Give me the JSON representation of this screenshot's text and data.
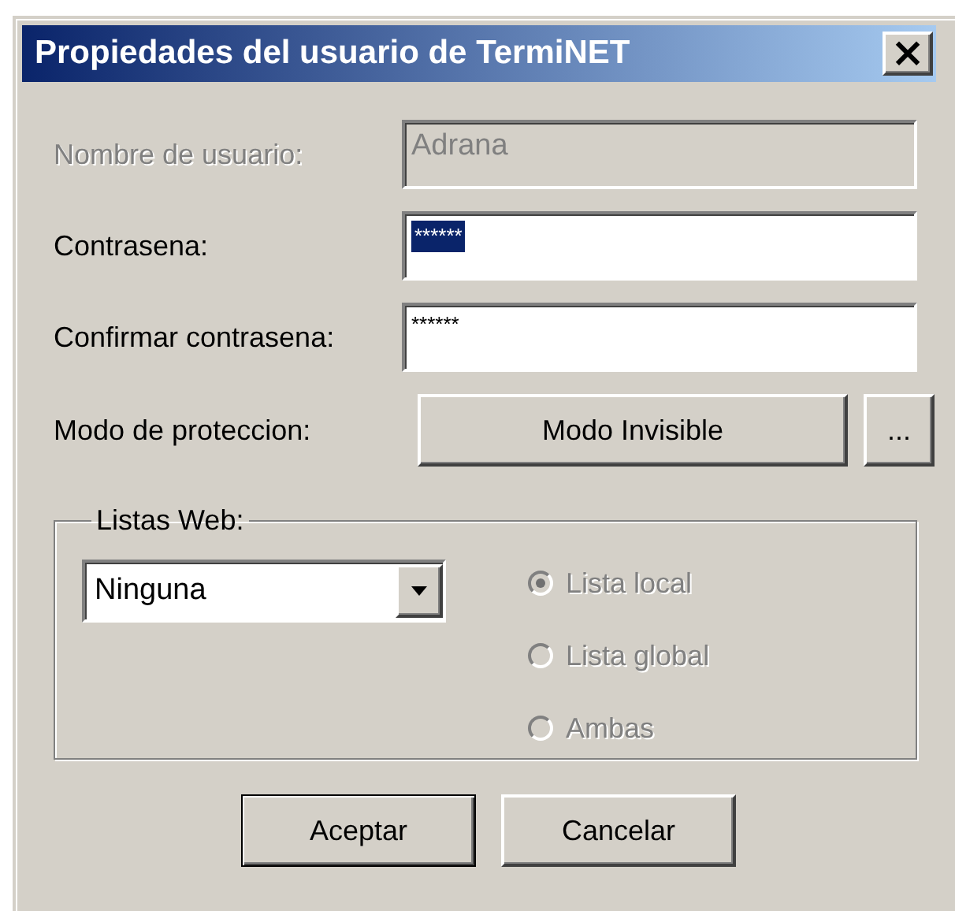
{
  "window": {
    "title": "Propiedades del usuario de TermiNET",
    "close": "×"
  },
  "fields": [
    {
      "label": "Nombre de usuario:",
      "value": "Adrana",
      "disabled": true,
      "selected": false
    },
    {
      "label": "Contrasena:",
      "value": "******",
      "disabled": false,
      "selected": true
    },
    {
      "label": "Confirmar contrasena:",
      "value": "******",
      "disabled": false,
      "selected": false
    }
  ],
  "protection": {
    "label": "Modo de proteccion:",
    "value": "Modo Invisible",
    "browse": "..."
  },
  "web_lists": {
    "legend": "Listas Web:",
    "combo": "Ninguna",
    "radios": [
      {
        "label": "Lista local",
        "selected": true,
        "disabled": true
      },
      {
        "label": "Lista global",
        "selected": false,
        "disabled": true
      },
      {
        "label": "Ambas",
        "selected": false,
        "disabled": true
      }
    ]
  },
  "buttons": [
    {
      "label": "Aceptar",
      "default": true
    },
    {
      "label": "Cancelar",
      "default": false
    }
  ]
}
